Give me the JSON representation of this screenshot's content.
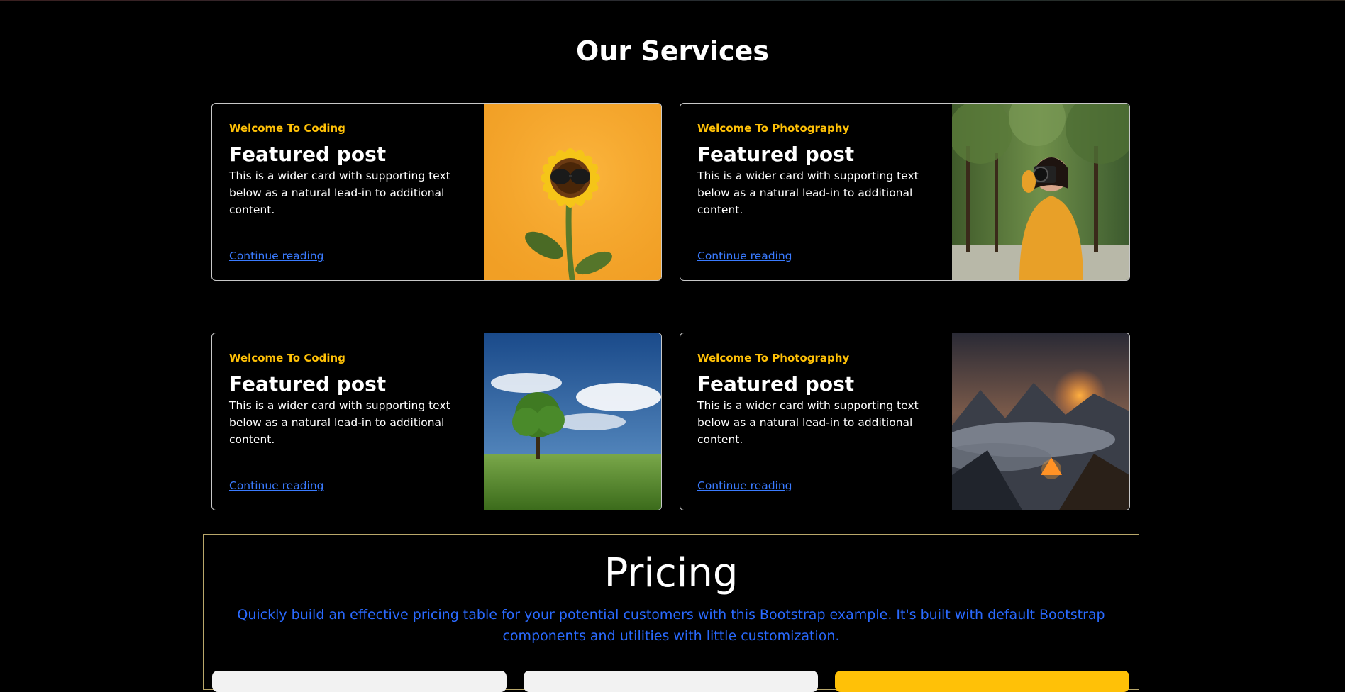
{
  "services": {
    "title": "Our Services",
    "cards": [
      {
        "kicker": "Welcome To Coding",
        "title": "Featured post",
        "text": "This is a wider card with supporting text below as a natural lead-in to additional content.",
        "link": "Continue reading",
        "image": "sunflower-with-sunglasses"
      },
      {
        "kicker": "Welcome To Photography",
        "title": "Featured post",
        "text": "This is a wider card with supporting text below as a natural lead-in to additional content.",
        "link": "Continue reading",
        "image": "woman-with-camera"
      },
      {
        "kicker": "Welcome To Coding",
        "title": "Featured post",
        "text": "This is a wider card with supporting text below as a natural lead-in to additional content.",
        "link": "Continue reading",
        "image": "tree-in-field"
      },
      {
        "kicker": "Welcome To Photography",
        "title": "Featured post",
        "text": "This is a wider card with supporting text below as a natural lead-in to additional content.",
        "link": "Continue reading",
        "image": "mountain-tent-sunset"
      }
    ]
  },
  "pricing": {
    "title": "Pricing",
    "lead": "Quickly build an effective pricing table for your potential customers with this Bootstrap example. It's built with default Bootstrap components and utilities with little customization."
  },
  "colors": {
    "background": "#000000",
    "accent": "#ffc107",
    "link": "#3a7bff",
    "lead": "#2a6aff"
  }
}
